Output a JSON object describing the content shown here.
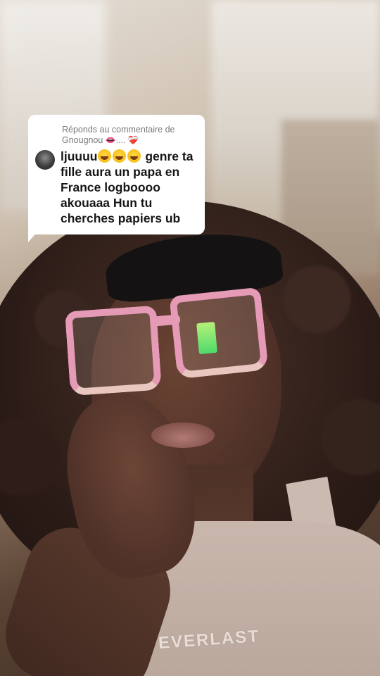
{
  "comment_reply": {
    "header_prefix": "Réponds au commentaire de",
    "commenter_name": "Gnougnou",
    "name_suffix_emojis": "👄.... ❤️‍🩹",
    "comment_text_start": "ljuuuu",
    "laugh_emoji_count": 3,
    "comment_text_rest": " genre ta fille aura un papa en France logboooo akouaaa Hun tu cherches papiers ub"
  },
  "scene": {
    "shirt_text": "EVERLAST"
  },
  "colors": {
    "bubble_bg": "#ffffff",
    "header_text": "#7a7a7a",
    "comment_text": "#161616",
    "glasses_frame": "#e59ab6"
  },
  "icons": {
    "avatar": "commenter-avatar",
    "emoji": "tears-of-joy-emoji"
  }
}
